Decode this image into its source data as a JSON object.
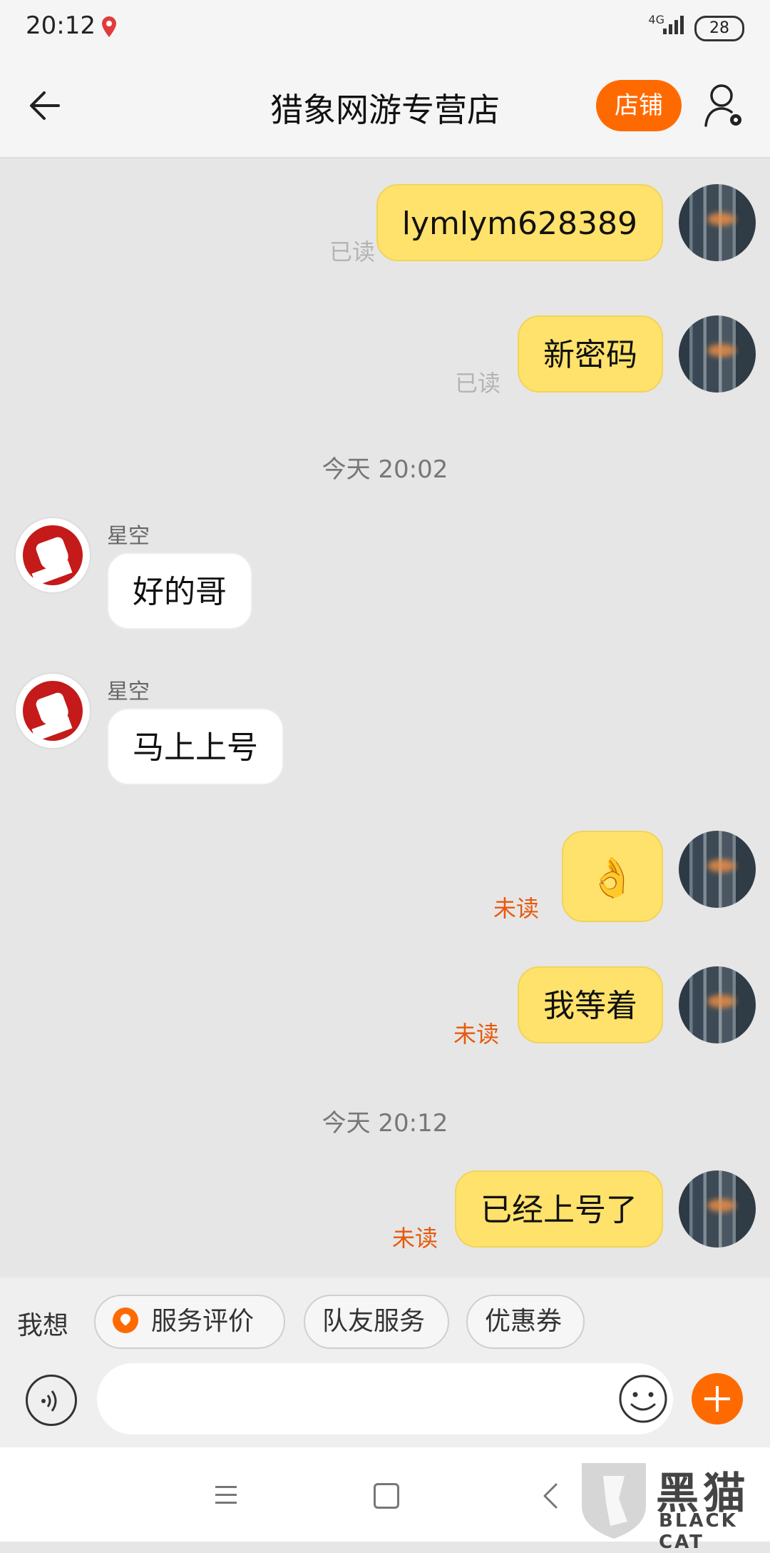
{
  "status_bar": {
    "time": "20:12",
    "network": "4G",
    "battery": "28"
  },
  "header": {
    "title": "猎象网游专营店",
    "shop_button": "店铺"
  },
  "messages": [
    {
      "text": "lymlym628389",
      "status": "已读"
    },
    {
      "text": "新密码",
      "status": "已读"
    },
    {
      "timestamp": "今天  20:02"
    },
    {
      "sender": "星空",
      "text": "好的哥"
    },
    {
      "sender": "星空",
      "text": "马上上号"
    },
    {
      "emoji": "👌",
      "status": "未读"
    },
    {
      "text": "我等着",
      "status": "未读"
    },
    {
      "timestamp": "今天  20:12"
    },
    {
      "text": "已经上号了",
      "status": "未读"
    }
  ],
  "quick_actions": {
    "label": "我想",
    "chips": [
      "服务评价",
      "队友服务",
      "优惠券"
    ]
  },
  "input": {
    "placeholder": ""
  },
  "watermark": {
    "text": "黑猫",
    "sub": "BLACK CAT"
  },
  "colors": {
    "accent": "#ff6a00",
    "my_bubble": "#ffe26b",
    "unread": "#e8590c"
  }
}
